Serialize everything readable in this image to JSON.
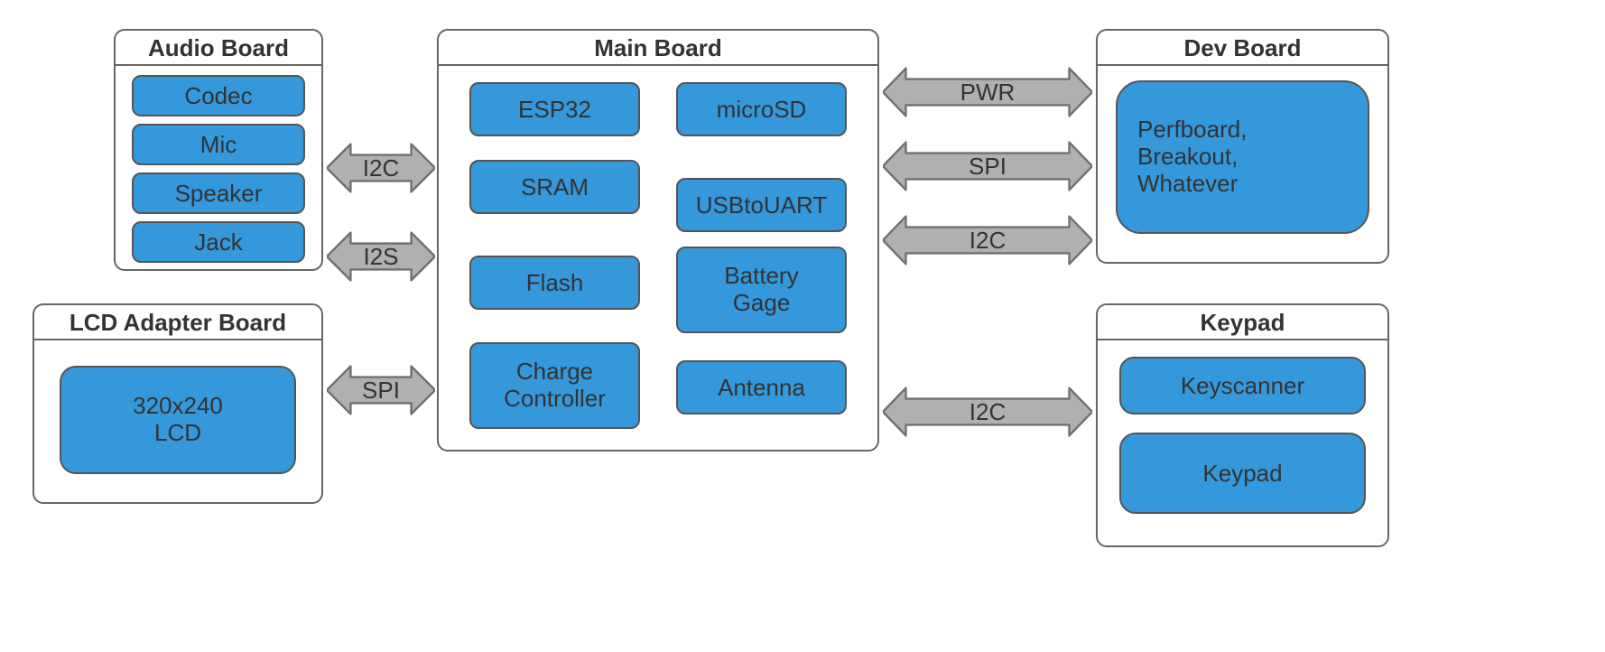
{
  "boards": {
    "audio": {
      "title": "Audio Board",
      "chips": [
        "Codec",
        "Mic",
        "Speaker",
        "Jack"
      ]
    },
    "lcd": {
      "title": "LCD Adapter Board",
      "chip_line1": "320x240",
      "chip_line2": "LCD"
    },
    "main": {
      "title": "Main Board",
      "left_col": [
        "ESP32",
        "SRAM",
        "Flash"
      ],
      "left_tall_line1": "Charge",
      "left_tall_line2": "Controller",
      "right_simple": [
        "microSD",
        "USBtoUART"
      ],
      "battery_line1": "Battery",
      "battery_line2": "Gage",
      "antenna": "Antenna"
    },
    "dev": {
      "title": "Dev Board",
      "chip_line1": "Perfboard,",
      "chip_line2": "Breakout,",
      "chip_line3": "Whatever"
    },
    "keypad": {
      "title": "Keypad",
      "chips": [
        "Keyscanner",
        "Keypad"
      ]
    }
  },
  "connections": {
    "left_i2c": "I2C",
    "left_i2s": "I2S",
    "left_spi": "SPI",
    "right_pwr": "PWR",
    "right_spi": "SPI",
    "right_i2c_top": "I2C",
    "right_i2c_bottom": "I2C"
  }
}
